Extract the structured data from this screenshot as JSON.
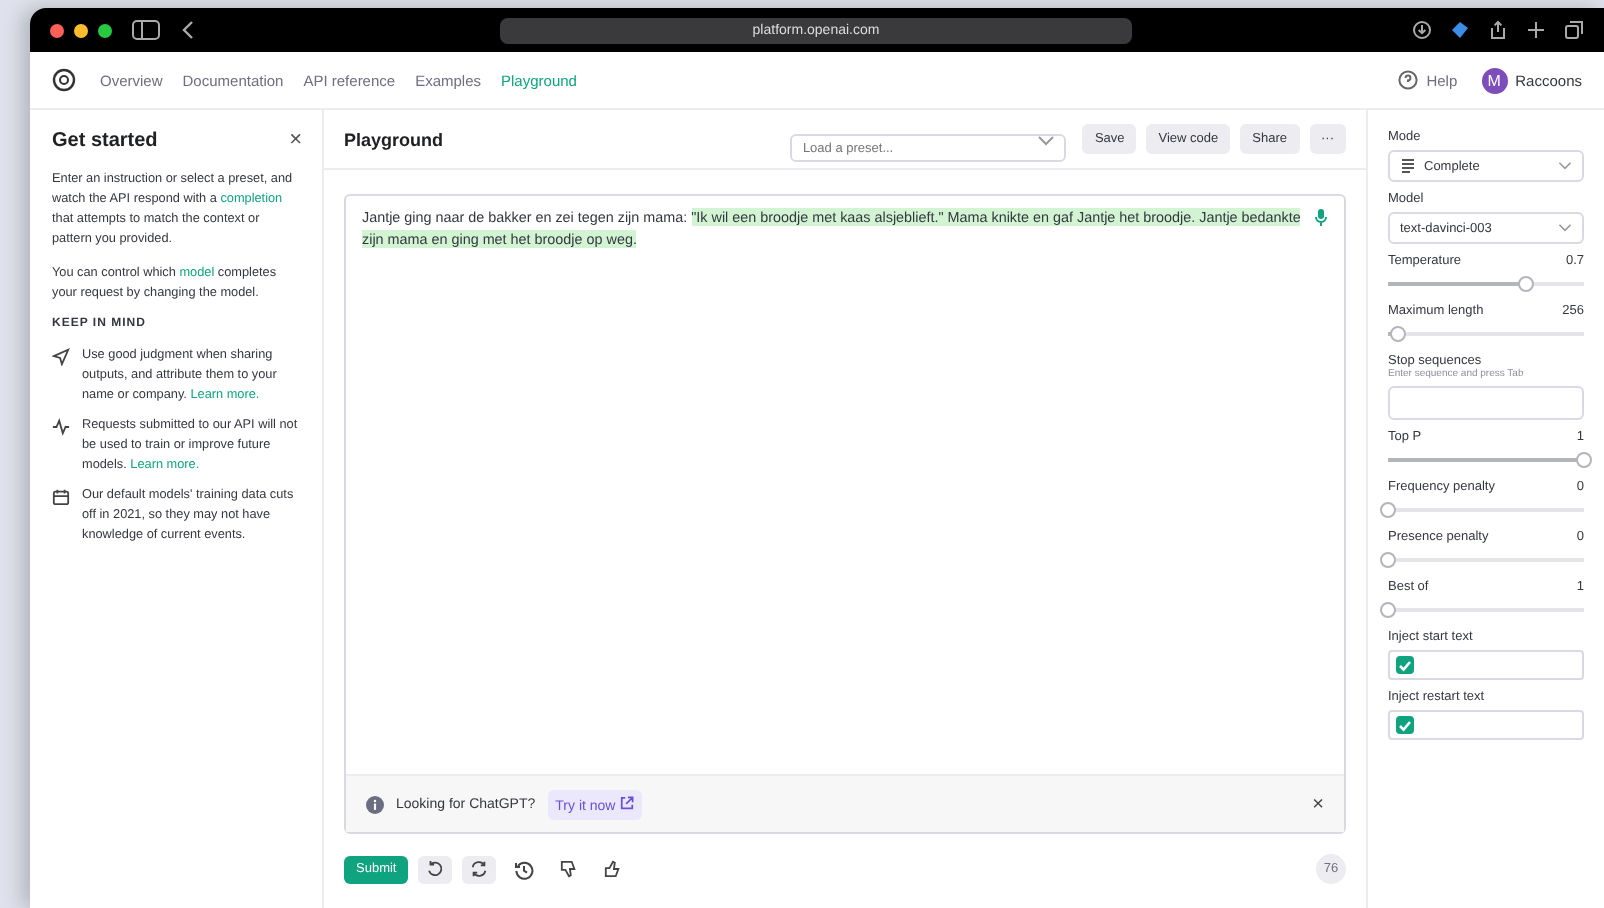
{
  "browser": {
    "url": "platform.openai.com"
  },
  "nav": {
    "items": [
      {
        "label": "Overview",
        "selected": false
      },
      {
        "label": "Documentation",
        "selected": false
      },
      {
        "label": "API reference",
        "selected": false
      },
      {
        "label": "Examples",
        "selected": false
      },
      {
        "label": "Playground",
        "selected": true
      }
    ],
    "help": "Help",
    "avatar": "M",
    "user": "Raccoons"
  },
  "sidebar": {
    "title": "Get started",
    "close": "×",
    "paragraphs": [
      [
        {
          "text": "Enter an instruction or select a preset, and watch the API respond with a "
        },
        {
          "link": "completion"
        },
        {
          "text": " that attempts to match the context or pattern you provided."
        }
      ],
      [
        {
          "text": "You can control which "
        },
        {
          "link": "model"
        },
        {
          "text": " completes your request by changing the model."
        }
      ]
    ],
    "heading": "KEEP IN MIND",
    "tips": [
      {
        "kind": "send",
        "text": "Use good judgment when sharing outputs, and attribute them to your name or company. ",
        "link": "Learn more."
      },
      {
        "kind": "pulse",
        "text": "Requests submitted to our API will not be used to train or improve future models. ",
        "link": "Learn more."
      },
      {
        "kind": "calendar",
        "text": "Our default models' training data cuts off in 2021, so they may not have knowledge of current events."
      }
    ]
  },
  "header": {
    "title": "Playground",
    "preset": {
      "placeholder": "Load a preset..."
    },
    "buttons": [
      "Save",
      "View code",
      "Share",
      "···"
    ]
  },
  "editor": {
    "prompt": "Jantje ging naar de bakker en zei tegen zijn mama: ",
    "completion": "\"Ik wil een broodje met kaas alsjeblieft.\" Mama knikte en gaf Jantje het broodje. Jantje bedankte zijn mama en ging met het broodje op weg.",
    "banner": {
      "text": "Looking for ChatGPT?",
      "link": "Try it now"
    }
  },
  "actions": {
    "submit": "Submit",
    "tokens": "76"
  },
  "settings": [
    {
      "kind": "select",
      "label": "Mode",
      "value": "Complete"
    },
    {
      "kind": "select",
      "label": "Model",
      "value": "text-davinci-003"
    },
    {
      "kind": "slider",
      "label": "Temperature",
      "reading": "0.7",
      "level": 0.7
    },
    {
      "kind": "slider",
      "label": "Maximum length",
      "reading": "256",
      "level": 0.05
    },
    {
      "kind": "input",
      "label": "Stop sequences",
      "hint": "Enter sequence and press Tab"
    },
    {
      "kind": "slider",
      "label": "Top P",
      "reading": "1",
      "level": 1
    },
    {
      "kind": "slider",
      "label": "Frequency penalty",
      "reading": "0",
      "level": 0
    },
    {
      "kind": "slider",
      "label": "Presence penalty",
      "reading": "0",
      "level": 0
    },
    {
      "kind": "slider",
      "label": "Best of",
      "reading": "1",
      "level": 0
    },
    {
      "kind": "check",
      "label": "Inject start text",
      "checked": true
    },
    {
      "kind": "check",
      "label": "Inject restart text",
      "checked": true
    }
  ]
}
